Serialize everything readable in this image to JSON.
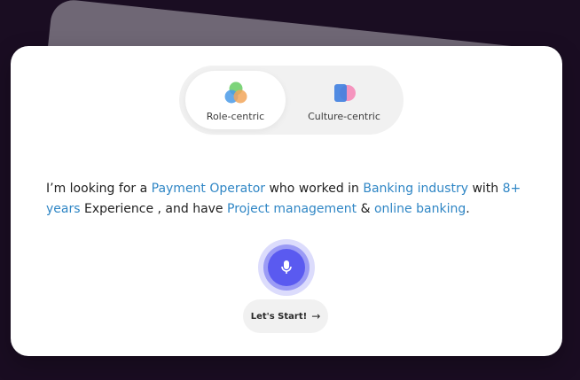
{
  "toggle": {
    "options": [
      {
        "label": "Role-centric",
        "icon": "overlapping-circles-icon",
        "selected": true
      },
      {
        "label": "Culture-centric",
        "icon": "overlapping-shapes-icon",
        "selected": false
      }
    ]
  },
  "prompt": {
    "t1": "I’m looking for a ",
    "k1": "Payment Operator",
    "t2": " who worked in ",
    "k2": "Banking industry",
    "t3": " with ",
    "k3": "8+ years",
    "t4": " Experience , and have ",
    "k4": "Project management",
    "t5": " & ",
    "k5": "online banking",
    "t6": "."
  },
  "mic": {
    "icon": "microphone-icon"
  },
  "cta": {
    "label": "Let's Start!",
    "icon": "arrow-right-icon",
    "arrow_glyph": "→"
  },
  "colors": {
    "keyword": "#2f86c5",
    "mic_primary": "#5a5af0",
    "background": "#1a0d22",
    "card": "#ffffff",
    "icon_green": "#6fcf6b",
    "icon_blue": "#4a9ae8",
    "icon_orange": "#f2a65a",
    "icon_pink": "#f58ab8"
  }
}
